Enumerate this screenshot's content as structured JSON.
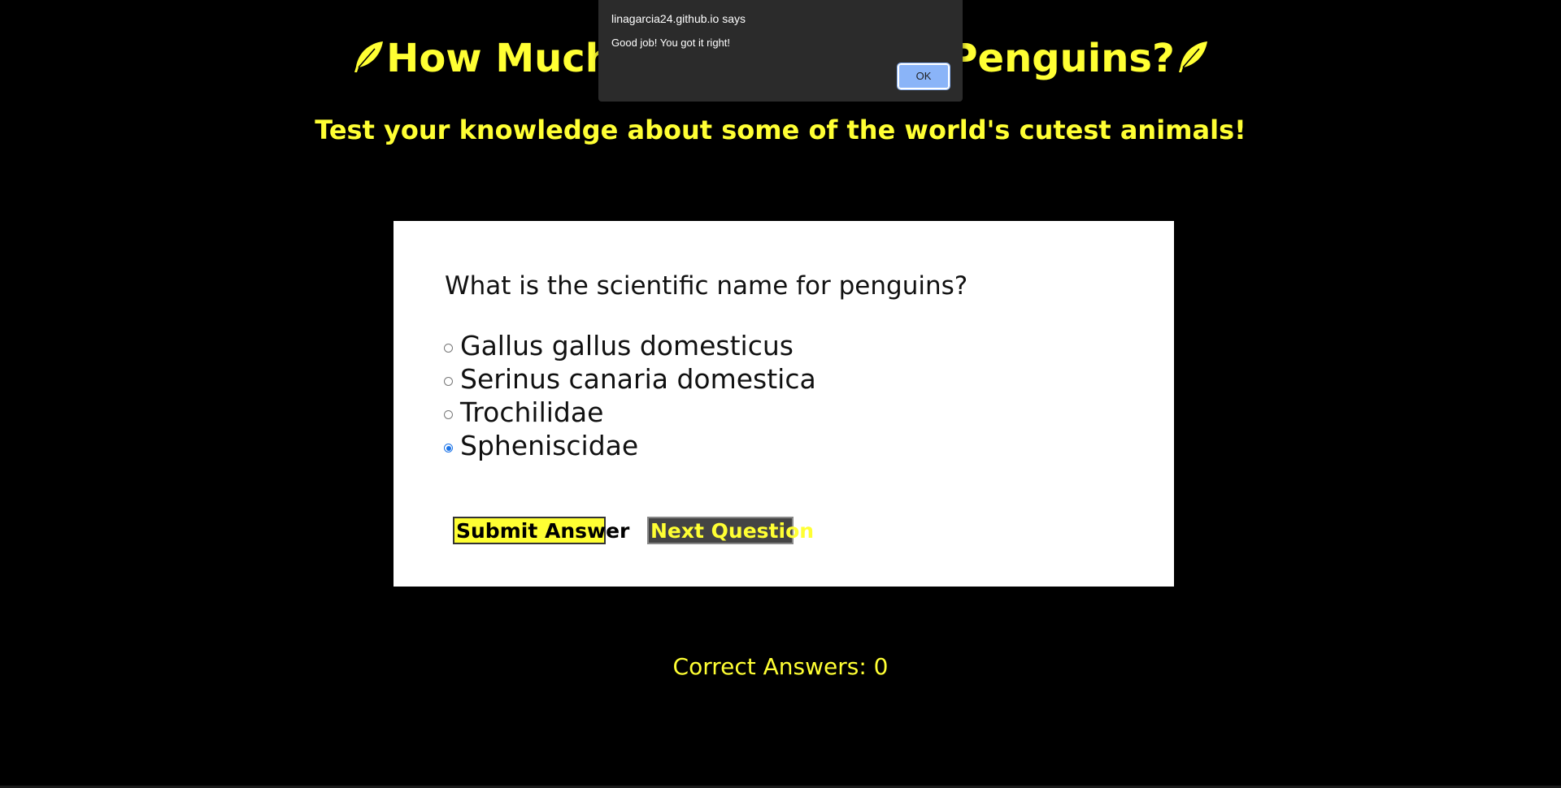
{
  "header": {
    "title_left": "How Much",
    "title_right": "Penguins?",
    "subtitle": "Test your knowledge about some of the world's cutest animals!",
    "accent_color": "#ffff33",
    "icon": "feather-icon"
  },
  "quiz": {
    "question": "What is the scientific name for penguins?",
    "options": [
      {
        "label": "Gallus gallus domesticus",
        "checked": false
      },
      {
        "label": "Serinus canaria domestica",
        "checked": false
      },
      {
        "label": "Trochilidae",
        "checked": false
      },
      {
        "label": "Spheniscidae",
        "checked": true
      }
    ],
    "submit_label": "Submit Answer",
    "next_label": "Next Question"
  },
  "score": {
    "text": "Correct Answers: 0"
  },
  "alert": {
    "origin": "linagarcia24.github.io says",
    "message": "Good job! You got it right!",
    "ok_label": "OK"
  }
}
